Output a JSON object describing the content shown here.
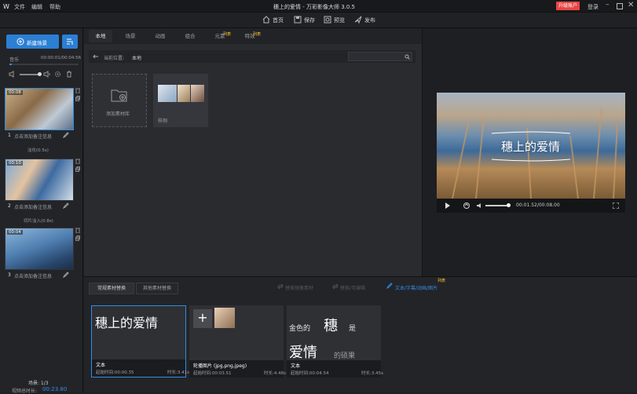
{
  "app": {
    "title": "穗上的爱情 - 万彩影像大师 3.0.5",
    "logo_icon": "app-logo-icon",
    "upgrade_label": "升级账户",
    "login_label": "登录"
  },
  "menu": [
    "文件",
    "编辑",
    "帮助"
  ],
  "toolbar": {
    "items": [
      {
        "label": "首页",
        "icon": "home-icon"
      },
      {
        "label": "保存",
        "icon": "save-icon"
      },
      {
        "label": "预览",
        "icon": "preview-icon"
      },
      {
        "label": "发布",
        "icon": "publish-icon"
      }
    ]
  },
  "left": {
    "new_scene_label": "新建场景",
    "music_label": "音乐",
    "music_time": "00:00:01/00:04:56",
    "scenes": [
      {
        "index": "1",
        "time": "00:08",
        "note": "点击添加备注信息",
        "transition": "淡化(0.5s)"
      },
      {
        "index": "2",
        "time": "00:10",
        "note": "点击添加备注信息",
        "transition": "切片淡入(0.8s)"
      },
      {
        "index": "3",
        "time": "00:04",
        "note": "点击添加备注信息"
      }
    ],
    "scene_counter_label": "场景: 1/3",
    "video_duration_label": "视频总时长:",
    "video_duration_value": "00:23.80"
  },
  "library": {
    "tabs": [
      {
        "label": "本地",
        "active": true
      },
      {
        "label": "场景"
      },
      {
        "label": "动画"
      },
      {
        "label": "组合"
      },
      {
        "label": "元素",
        "badge": "列表"
      },
      {
        "label": "特效",
        "badge": "列表"
      }
    ],
    "location_label": "当前位置:",
    "location_value": "本地",
    "add_folder_label": "添加素材库",
    "sample_folder_label": "样例"
  },
  "preview": {
    "title_text": "穗上的爱情",
    "time": "00:01.52/00:08.00",
    "progress": 0.19
  },
  "bottom": {
    "tabs": [
      {
        "label": "常规素材替换",
        "active": true
      },
      {
        "label": "其他素材替换"
      }
    ],
    "actions": [
      {
        "label": "替换镜像素材"
      },
      {
        "label": "替换/可编辑"
      },
      {
        "label": "文本/字幕/动画/图片",
        "badge": "列表"
      }
    ],
    "cards": [
      {
        "big_text": "穗上的爱情",
        "type": "文本",
        "start": "起始时间:00:00.35",
        "duration": "时长:3.41s"
      },
      {
        "type": "轮播图片 (jpg,png,jpeg)",
        "start": "起始时间:00:03.51",
        "duration": "时长:4.48s"
      },
      {
        "big_text": "金色的穗是爱情的硕果",
        "word_a": "金色的",
        "word_b": "穗",
        "word_c": "是",
        "word_d": "爱情",
        "word_e": "的硕果",
        "type": "文本",
        "start": "起始时间:00:04.54",
        "duration": "时长:3.45s"
      }
    ]
  }
}
